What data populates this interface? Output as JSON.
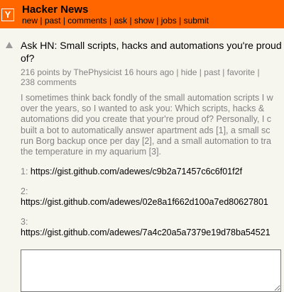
{
  "header": {
    "logo_letter": "Y",
    "site_name": "Hacker News",
    "nav": [
      "new",
      "past",
      "comments",
      "ask",
      "show",
      "jobs",
      "submit"
    ]
  },
  "story": {
    "title_line1": "Ask HN: Small scripts, hacks and automations you're proud",
    "title_line2": "of?",
    "points": "216 points",
    "by": "by",
    "author": "ThePhysicist",
    "age": "16 hours ago",
    "actions": [
      "hide",
      "past",
      "favorite"
    ],
    "comments": "238 comments",
    "body_lines": [
      "I sometimes think back fondly of the small automation scripts I w",
      "over the years, so I wanted to ask you: Which scripts, hacks &",
      "automations did you create that your're proud of? Personally, I c",
      "built a bot to automatically answer apartment ads [1], a small sc",
      "run Borg backup once per day [2], and a small automation to tra",
      "the temperature in my aquarium [3]."
    ],
    "links": [
      {
        "num": "1:",
        "url": "https://gist.github.com/adewes/c9b2a71457c6c6f01f2f"
      },
      {
        "num": "2:",
        "url": "https://gist.github.com/adewes/02e8a1f662d100a7ed80627801"
      },
      {
        "num": "3:",
        "url": "https://gist.github.com/adewes/7a4c20a5a7379e19d78ba54521"
      }
    ]
  }
}
